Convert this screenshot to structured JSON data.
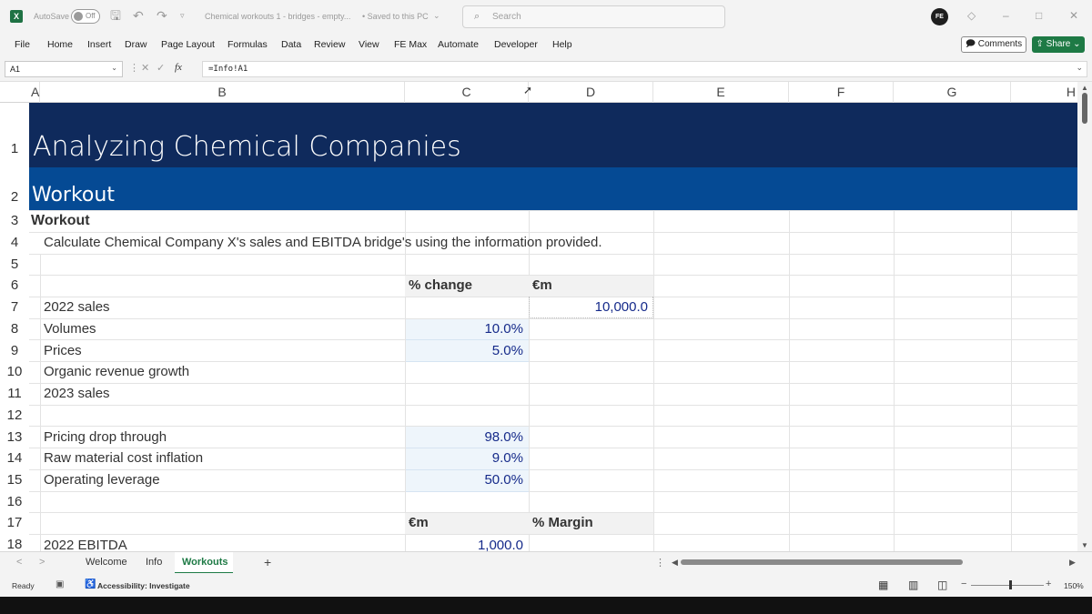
{
  "titlebar": {
    "app_icon": "X",
    "autosave_label": "AutoSave",
    "autosave_state": "Off",
    "document_title": "Chemical workouts 1 - bridges - empty...",
    "save_status": "• Saved to this PC",
    "search_placeholder": "Search",
    "avatar_initials": "FE",
    "icons": [
      "save-icon",
      "undo-icon",
      "redo-icon",
      "diamond-icon",
      "minimize-icon",
      "restore-icon",
      "close-icon"
    ]
  },
  "menu": {
    "items": [
      "File",
      "Home",
      "Insert",
      "Draw",
      "Page Layout",
      "Formulas",
      "Data",
      "Review",
      "View",
      "FE Max",
      "Automate",
      "Developer",
      "Help"
    ],
    "comments_label": "Comments",
    "share_label": "Share"
  },
  "formula_bar": {
    "name_box": "A1",
    "fx_label": "fx",
    "formula": "=Info!A1"
  },
  "columns": [
    "A",
    "B",
    "C",
    "D",
    "E",
    "F",
    "G",
    "H"
  ],
  "rows": [
    "1",
    "2",
    "3",
    "4",
    "5",
    "6",
    "7",
    "8",
    "9",
    "10",
    "11",
    "12",
    "13",
    "14",
    "15",
    "16",
    "17",
    "18"
  ],
  "sheet": {
    "title": "Analyzing Chemical Companies",
    "subtitle": "Workout",
    "section_heading": "Workout",
    "instruction": "Calculate Chemical Company X's sales and EBITDA bridge's using the information provided.",
    "table1_header_pct": "% change",
    "table1_header_eur": "€m",
    "table1_rows": [
      {
        "label": "2022 sales",
        "pct": "",
        "eur": "10,000.0"
      },
      {
        "label": "Volumes",
        "pct": "10.0%",
        "eur": ""
      },
      {
        "label": "Prices",
        "pct": "5.0%",
        "eur": ""
      },
      {
        "label": "Organic revenue growth",
        "pct": "",
        "eur": ""
      },
      {
        "label": "2023 sales",
        "pct": "",
        "eur": ""
      }
    ],
    "assumptions": [
      {
        "label": "Pricing drop through",
        "pct": "98.0%"
      },
      {
        "label": "Raw material cost inflation",
        "pct": "9.0%"
      },
      {
        "label": "Operating leverage",
        "pct": "50.0%"
      }
    ],
    "table2_header_eur": "€m",
    "table2_header_margin": "% Margin",
    "table2_rows": [
      {
        "label": "2022 EBITDA",
        "eur": "1,000.0"
      }
    ]
  },
  "tabs": {
    "items": [
      "Welcome",
      "Info",
      "Workouts"
    ],
    "active": "Workouts",
    "add": "+"
  },
  "status": {
    "ready": "Ready",
    "accessibility": "Accessibility: Investigate",
    "zoom": "150%"
  },
  "colors": {
    "banner_dark": "#0f2a5c",
    "banner_blue": "#054a94",
    "input_number": "#152a8a",
    "excel_green": "#1e7a45"
  }
}
